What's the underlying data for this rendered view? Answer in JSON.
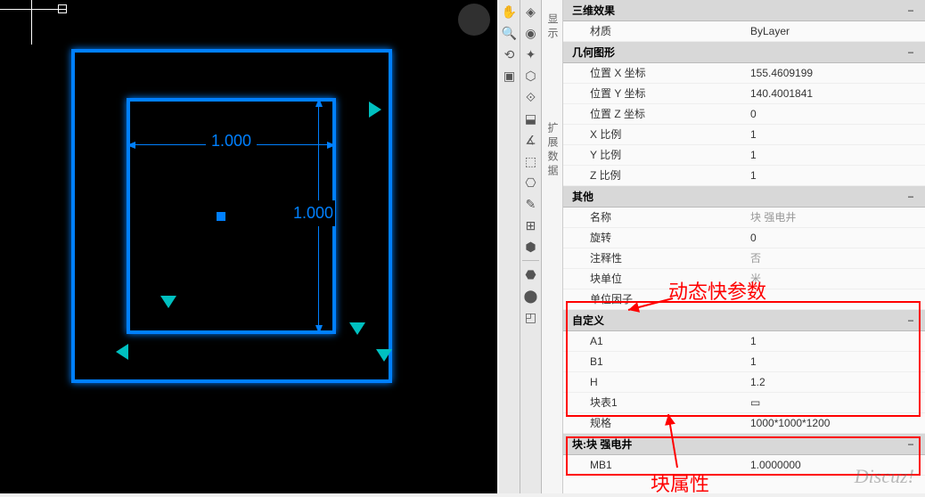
{
  "drawing": {
    "dim_horizontal": "1.000",
    "dim_vertical": "1.000"
  },
  "vtabs": {
    "tab1": "显示",
    "tab2": "扩展数据"
  },
  "sections": {
    "effect3d": {
      "title": "三维效果",
      "collapse": "−"
    },
    "geometry": {
      "title": "几何图形",
      "collapse": "−"
    },
    "other": {
      "title": "其他",
      "collapse": "−"
    },
    "custom": {
      "title": "自定义",
      "collapse": "−"
    },
    "block": {
      "title": "块:块 强电井",
      "collapse": "−"
    }
  },
  "props": {
    "material": {
      "label": "材质",
      "value": "ByLayer"
    },
    "posx": {
      "label": "位置 X 坐标",
      "value": "155.4609199"
    },
    "posy": {
      "label": "位置 Y 坐标",
      "value": "140.4001841"
    },
    "posz": {
      "label": "位置 Z 坐标",
      "value": "0"
    },
    "scalex": {
      "label": "X 比例",
      "value": "1"
    },
    "scaley": {
      "label": "Y 比例",
      "value": "1"
    },
    "scalez": {
      "label": "Z 比例",
      "value": "1"
    },
    "name": {
      "label": "名称",
      "value": "块 强电井"
    },
    "rotation": {
      "label": "旋转",
      "value": "0"
    },
    "annotative": {
      "label": "注释性",
      "value": "否"
    },
    "blockunit": {
      "label": "块单位",
      "value": "米"
    },
    "unitfactor": {
      "label": "单位因子",
      "value": ""
    },
    "a1": {
      "label": "A1",
      "value": "1"
    },
    "b1": {
      "label": "B1",
      "value": "1"
    },
    "h": {
      "label": "H",
      "value": "1.2"
    },
    "table1": {
      "label": "块表1",
      "value": "▭"
    },
    "spec": {
      "label": "规格",
      "value": "1000*1000*1200"
    },
    "mb1": {
      "label": "MB1",
      "value": "1.0000000"
    }
  },
  "annotations": {
    "dynamic_params": "动态快参数",
    "block_attrs": "块属性"
  },
  "watermark": "Discuz!"
}
